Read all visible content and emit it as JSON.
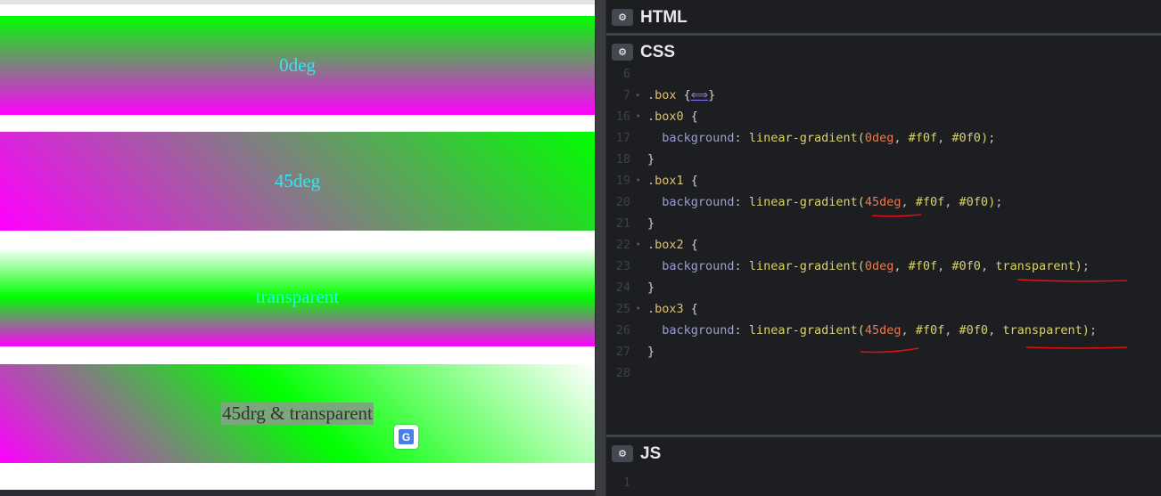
{
  "preview": {
    "boxes": [
      {
        "label": "0deg"
      },
      {
        "label": "45deg"
      },
      {
        "label": "transparent"
      },
      {
        "label": "45drg & transparent"
      }
    ]
  },
  "panels": {
    "html": {
      "title": "HTML"
    },
    "css": {
      "title": "CSS"
    },
    "js": {
      "title": "JS"
    }
  },
  "css_code": [
    {
      "ln": "6",
      "fold": "",
      "parts": []
    },
    {
      "ln": "7",
      "fold": "▸",
      "parts": [
        [
          "sel",
          ".box"
        ],
        [
          "brace",
          " {"
        ],
        [
          "ellip",
          "⟺"
        ],
        [
          "brace",
          "}"
        ]
      ]
    },
    {
      "ln": "16",
      "fold": "▾",
      "parts": [
        [
          "sel",
          ".box0"
        ],
        [
          "brace",
          " {"
        ]
      ]
    },
    {
      "ln": "17",
      "fold": "",
      "parts": [
        [
          "prop",
          "  background"
        ],
        [
          "punct",
          ": "
        ],
        [
          "fn",
          "linear-gradient("
        ],
        [
          "num",
          "0deg"
        ],
        [
          "punct",
          ", "
        ],
        [
          "val",
          "#f0f"
        ],
        [
          "punct",
          ", "
        ],
        [
          "val",
          "#0f0"
        ],
        [
          "fn",
          ")"
        ],
        [
          "punct",
          ";"
        ]
      ]
    },
    {
      "ln": "18",
      "fold": "",
      "parts": [
        [
          "brace",
          "}"
        ]
      ]
    },
    {
      "ln": "19",
      "fold": "▾",
      "parts": [
        [
          "sel",
          ".box1"
        ],
        [
          "brace",
          " {"
        ]
      ]
    },
    {
      "ln": "20",
      "fold": "",
      "parts": [
        [
          "prop",
          "  background"
        ],
        [
          "punct",
          ": "
        ],
        [
          "fn",
          "linear-gradient("
        ],
        [
          "num",
          "45deg"
        ],
        [
          "punct",
          ", "
        ],
        [
          "val",
          "#f0f"
        ],
        [
          "punct",
          ", "
        ],
        [
          "val",
          "#0f0"
        ],
        [
          "fn",
          ")"
        ],
        [
          "punct",
          ";"
        ]
      ]
    },
    {
      "ln": "21",
      "fold": "",
      "parts": [
        [
          "brace",
          "}"
        ]
      ]
    },
    {
      "ln": "22",
      "fold": "▾",
      "parts": [
        [
          "sel",
          ".box2"
        ],
        [
          "brace",
          " {"
        ]
      ]
    },
    {
      "ln": "23",
      "fold": "",
      "parts": [
        [
          "prop",
          "  background"
        ],
        [
          "punct",
          ": "
        ],
        [
          "fn",
          "linear-gradient("
        ],
        [
          "num",
          "0deg"
        ],
        [
          "punct",
          ", "
        ],
        [
          "val",
          "#f0f"
        ],
        [
          "punct",
          ", "
        ],
        [
          "val",
          "#0f0"
        ],
        [
          "punct",
          ", "
        ],
        [
          "val",
          "transparent"
        ],
        [
          "fn",
          ")"
        ],
        [
          "punct",
          ";"
        ]
      ]
    },
    {
      "ln": "24",
      "fold": "",
      "parts": [
        [
          "brace",
          "}"
        ]
      ]
    },
    {
      "ln": "25",
      "fold": "▾",
      "parts": [
        [
          "sel",
          ".box3"
        ],
        [
          "brace",
          " {"
        ]
      ]
    },
    {
      "ln": "26",
      "fold": "",
      "parts": [
        [
          "prop",
          "  background"
        ],
        [
          "punct",
          ": "
        ],
        [
          "fn",
          "linear-gradient("
        ],
        [
          "num",
          "45deg"
        ],
        [
          "punct",
          ", "
        ],
        [
          "val",
          "#f0f"
        ],
        [
          "punct",
          ", "
        ],
        [
          "val",
          "#0f0"
        ],
        [
          "punct",
          ", "
        ],
        [
          "val",
          "transparent"
        ],
        [
          "fn",
          ")"
        ],
        [
          "punct",
          ";"
        ]
      ]
    },
    {
      "ln": "27",
      "fold": "",
      "parts": [
        [
          "brace",
          "}"
        ]
      ]
    },
    {
      "ln": "28",
      "fold": "",
      "parts": []
    }
  ],
  "js_code": [
    {
      "ln": "1"
    }
  ],
  "colors": {
    "editor_bg": "#1d1e22",
    "annotation_red": "#e01010",
    "gradient_magenta": "#f0f",
    "gradient_green": "#0f0"
  },
  "icons": {
    "panel_settings": "gear-icon",
    "translate": "translate-icon"
  }
}
